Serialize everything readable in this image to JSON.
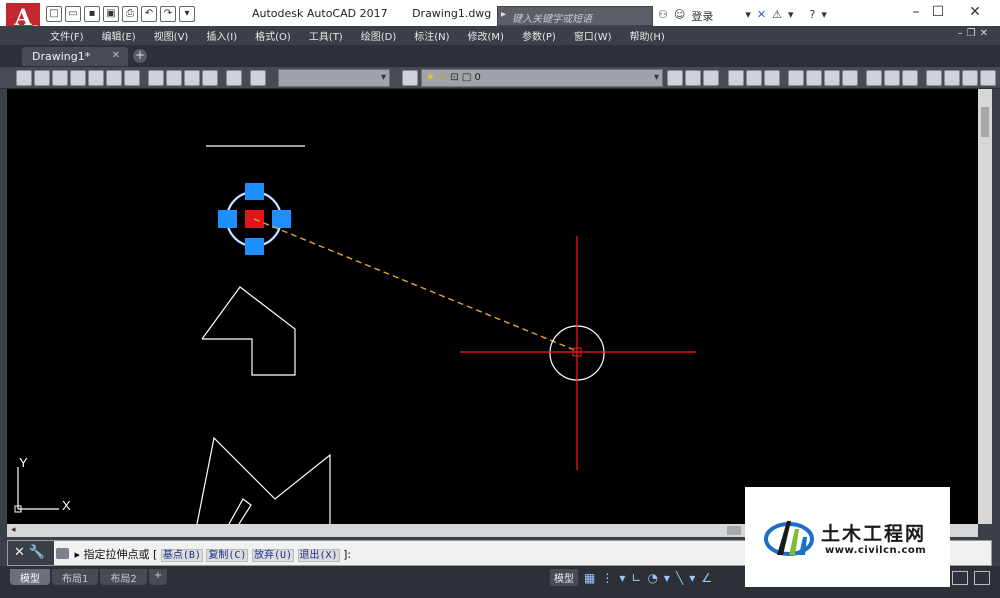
{
  "app": {
    "logo_letter": "A",
    "title": "Autodesk AutoCAD 2017",
    "document": "Drawing1.dwg",
    "search_placeholder": "键入关键字或短语",
    "login_label": "登录"
  },
  "menu": {
    "items": [
      "文件(F)",
      "编辑(E)",
      "视图(V)",
      "插入(I)",
      "格式(O)",
      "工具(T)",
      "绘图(D)",
      "标注(N)",
      "修改(M)",
      "参数(P)",
      "窗口(W)",
      "帮助(H)"
    ]
  },
  "tabs": {
    "active": "Drawing1*",
    "close_icon": "close-icon",
    "add_icon": "plus-icon"
  },
  "toolbar": {
    "layer_value": "0"
  },
  "canvas": {
    "background": "#000000",
    "ucs_y": "Y",
    "ucs_x": "X",
    "grip_color": "#1e8fff",
    "hot_grip_color": "#e0151a",
    "crosshair_color": "#ff1a1a",
    "rubberband_color": "#e8a23a"
  },
  "command": {
    "prompt": "指定拉伸点或",
    "open_bracket": "[",
    "options": [
      "基点(B)",
      "复制(C)",
      "放弃(U)",
      "退出(X)"
    ],
    "close": "]:"
  },
  "layout_tabs": [
    "模型",
    "布局1",
    "布局2"
  ],
  "status": {
    "model_label": "模型"
  },
  "watermark": {
    "name": "土木工程网",
    "url": "www.civilcn.com"
  }
}
